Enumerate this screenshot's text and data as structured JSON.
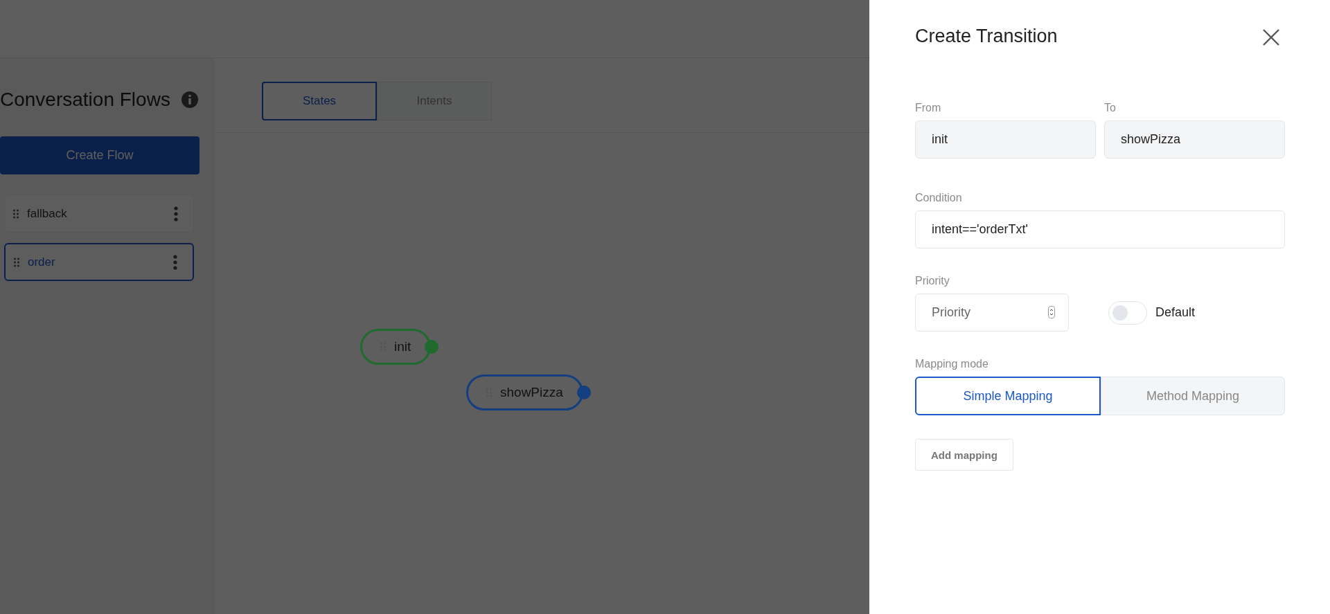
{
  "sidebar": {
    "title": "Conversation Flows",
    "create_button": "Create Flow",
    "flows": [
      {
        "name": "fallback",
        "selected": false
      },
      {
        "name": "order",
        "selected": true
      }
    ]
  },
  "view_tabs": [
    {
      "label": "States",
      "selected": true
    },
    {
      "label": "Intents",
      "selected": false
    }
  ],
  "canvas": {
    "nodes": [
      {
        "label": "init",
        "color": "#1f6b2d"
      },
      {
        "label": "showPizza",
        "color": "#133e80"
      }
    ]
  },
  "dialog": {
    "title": "Create Transition",
    "from": {
      "label": "From",
      "value": "init"
    },
    "to": {
      "label": "To",
      "value": "showPizza"
    },
    "condition": {
      "label": "Condition",
      "value": "intent=='orderTxt'"
    },
    "priority": {
      "label": "Priority",
      "placeholder": "Priority"
    },
    "default_toggle": {
      "label": "Default",
      "on": false
    },
    "mapping_mode": {
      "label": "Mapping mode",
      "options": [
        {
          "label": "Simple Mapping",
          "selected": true
        },
        {
          "label": "Method Mapping",
          "selected": false
        }
      ]
    },
    "add_button": "Add mapping"
  }
}
